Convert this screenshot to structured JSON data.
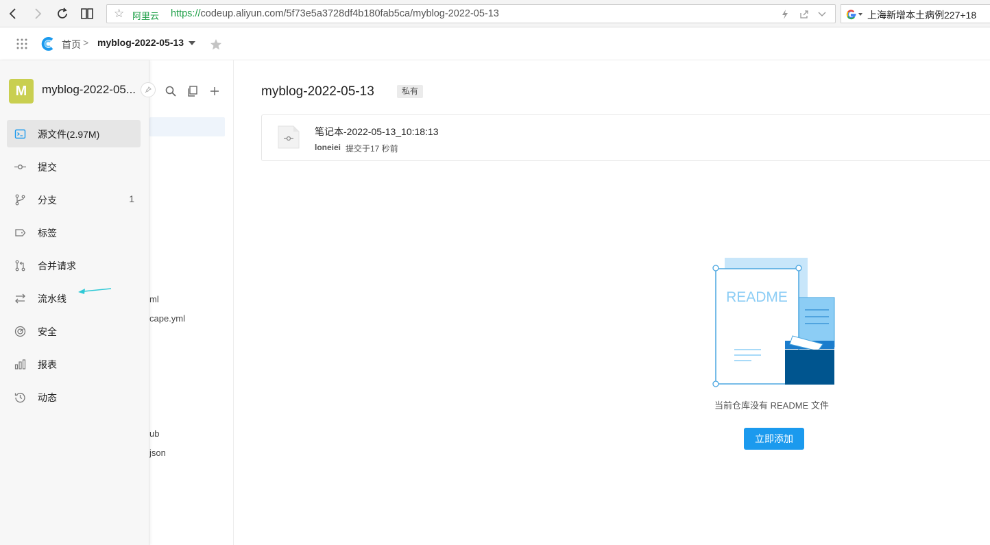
{
  "browser": {
    "site_label": "阿里云",
    "url_scheme": "https://",
    "url_rest": "codeup.aliyun.com/5f73e5a3728df4b180fab5ca/myblog-2022-05-13",
    "search_text": "上海新增本土病例227+18"
  },
  "header": {
    "breadcrumb_home": "首页",
    "breadcrumb_sep": ">",
    "repo_name": "myblog-2022-05-13"
  },
  "sidebar": {
    "avatar_letter": "M",
    "repo_name": "myblog-2022-05...",
    "items": [
      {
        "label": "源文件(2.97M)",
        "icon": "code-file-icon",
        "active": true
      },
      {
        "label": "提交",
        "icon": "commit-icon"
      },
      {
        "label": "分支",
        "icon": "branch-icon",
        "count": "1"
      },
      {
        "label": "标签",
        "icon": "tag-icon"
      },
      {
        "label": "合并请求",
        "icon": "merge-request-icon"
      },
      {
        "label": "流水线",
        "icon": "pipeline-icon"
      },
      {
        "label": "安全",
        "icon": "security-icon"
      },
      {
        "label": "报表",
        "icon": "report-icon"
      },
      {
        "label": "动态",
        "icon": "history-icon"
      }
    ]
  },
  "file_panel": {
    "files": [
      "ml",
      "cape.yml",
      "ub",
      "json"
    ]
  },
  "main": {
    "title": "myblog-2022-05-13",
    "visibility_badge": "私有",
    "commit": {
      "message": "笔记本-2022-05-13_10:18:13",
      "author": "loneiei",
      "time": "提交于17 秒前"
    },
    "readme_illustration_text": "README",
    "empty_text": "当前仓库没有 README 文件",
    "add_button": "立即添加"
  },
  "colors": {
    "accent": "#1b9aee",
    "avatar": "#c9cf50",
    "annotation_arrow": "#2ec9d6"
  }
}
